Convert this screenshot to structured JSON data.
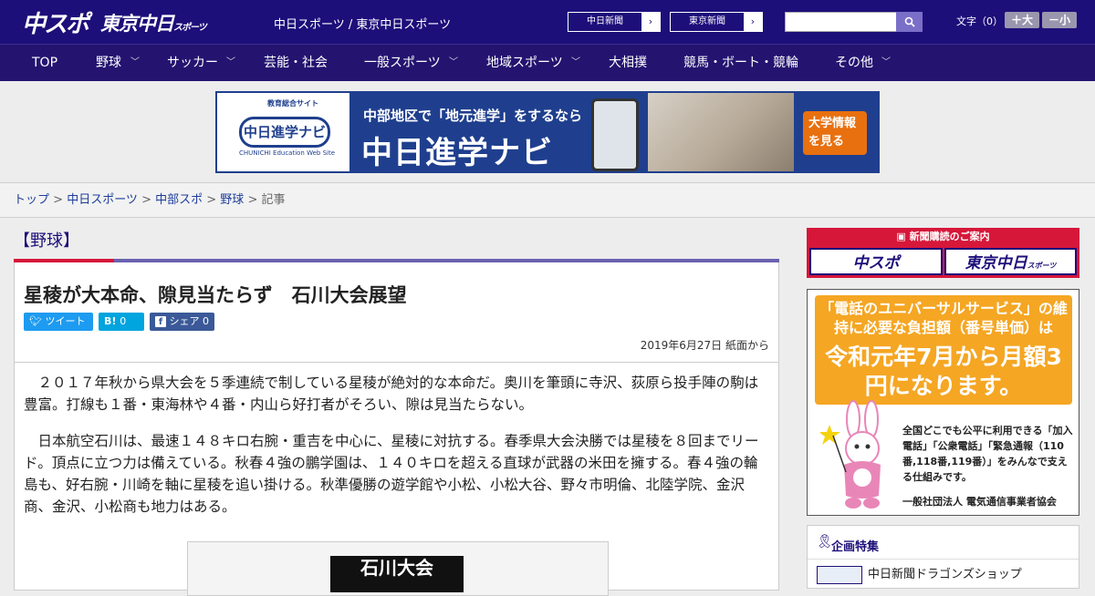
{
  "header": {
    "logo_chunichi": "中スポ",
    "logo_tokyo": "東京中日",
    "logo_tokyo_suffix": "スポーツ",
    "site_title": "中日スポーツ / 東京中日スポーツ",
    "btn_chunichi": "中日新聞",
    "btn_tokyo": "東京新聞",
    "search_placeholder": "",
    "font_size_label": "文字（0）",
    "font_bigger": "＋大",
    "font_smaller": "－小"
  },
  "nav": {
    "items": [
      "TOP",
      "野球",
      "サッカー",
      "芸能・社会",
      "一般スポーツ",
      "地域スポーツ",
      "大相撲",
      "競馬・ボート・競輪",
      "その他"
    ]
  },
  "banner": {
    "site_label": "教育総合サイト",
    "logo_text": "中日進学ナビ",
    "logo_sub": "CHUNICHI Education Web Site",
    "line1": "中部地区で「地元進学」をするなら",
    "line2": "中日進学ナビ",
    "cta": "大学情報を見る"
  },
  "breadcrumb": {
    "items": [
      "トップ",
      "中日スポーツ",
      "中部スポ",
      "野球"
    ],
    "current": "記事",
    "sep": " > "
  },
  "article": {
    "category": "【野球】",
    "headline": "星稜が大本命、隙見当たらず　石川大会展望",
    "tweet": "ツイート",
    "hatena": "B!",
    "hatena_count": "0",
    "share": "シェア",
    "share_count": "0",
    "date": "2019年6月27日 紙面から",
    "para1": "　２０１７年秋から県大会を５季連続で制している星稜が絶対的な本命だ。奥川を筆頭に寺沢、荻原ら投手陣の駒は豊富。打線も１番・東海林や４番・内山ら好打者がそろい、隙は見当たらない。",
    "para2": "　日本航空石川は、最速１４８キロ右腕・重吉を中心に、星稜に対抗する。春季県大会決勝では星稜を８回までリード。頂点に立つ力は備えている。秋春４強の鵬学園は、１４０キロを超える直球が武器の米田を擁する。春４強の輪島も、好右腕・川崎を軸に星稜を追い掛ける。秋準優勝の遊学館や小松、小松大谷、野々市明倫、北陸学院、金沢商、金沢、小松商も地力はある。",
    "figure_title": "石川大会"
  },
  "sidebar": {
    "subscribe_header": "新聞購読のご案内",
    "sub_chunichi": "中スポ",
    "sub_tokyo": "東京中日",
    "sub_tokyo_suffix": "スポーツ",
    "ad_line1": "「電話のユニバーサルサービス」の維持に必要な負担額（番号単価）は",
    "ad_line2": "令和元年7月から月額3円になります。",
    "ad_text": "全国どこでも公平に利用できる「加入電話」「公衆電話」「緊急通報（110番,118番,119番）」をみんなで支える仕組みです。",
    "ad_org": "一般社団法人 電気通信事業者協会",
    "feature_title": "企画特集",
    "feature_item": "中日新聞ドラゴンズショップ"
  },
  "colors": {
    "header_bg": "#1d0f7a",
    "nav_bg": "#241470",
    "accent_red": "#d6173a",
    "link": "#1d3d9a"
  }
}
